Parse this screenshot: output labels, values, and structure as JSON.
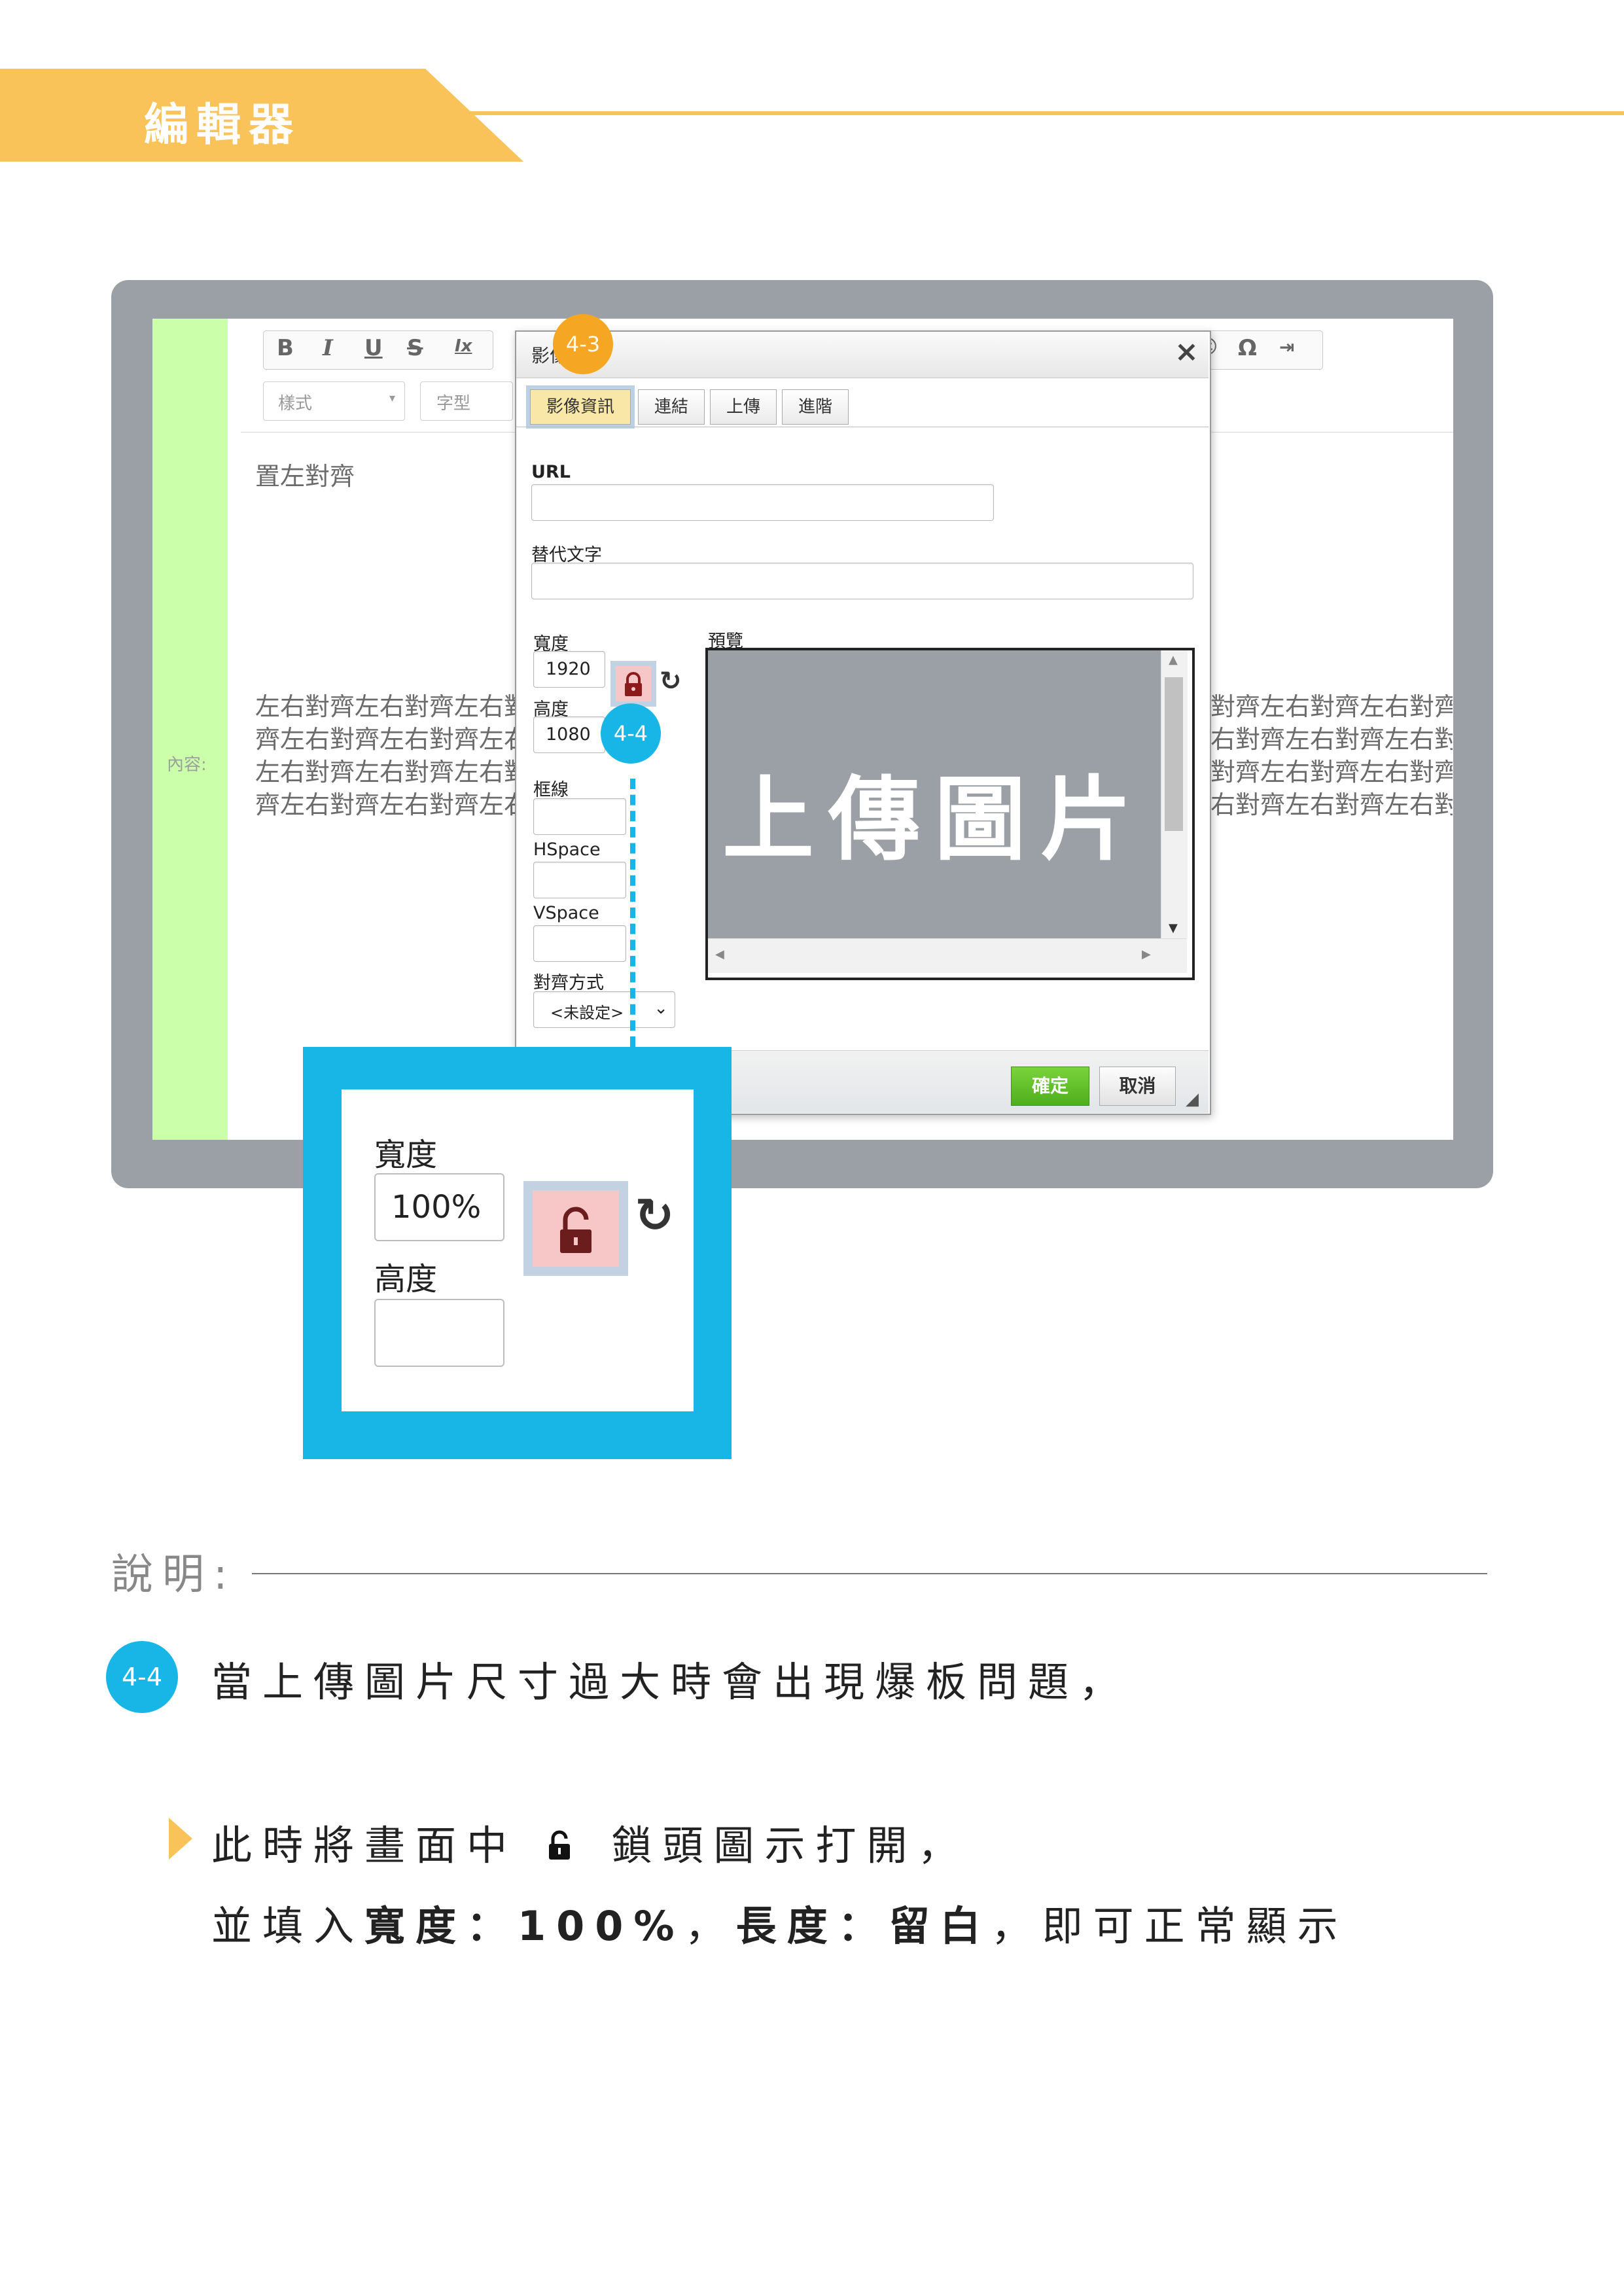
{
  "header": {
    "title": "編輯器"
  },
  "editor": {
    "toolbar": {
      "bold": "B",
      "italic": "I",
      "underline": "U",
      "strike": "S",
      "clear_format": "Ix",
      "omega": "Ω"
    },
    "format_combo": "樣式",
    "font_combo": "字型",
    "content_label": "內容:",
    "text_left": "置左對齊",
    "text_justify_left": [
      "左右對齊左右對齊左右對",
      "齊左右對齊左右對齊左右",
      "左右對齊左右對齊左右對",
      "齊左右對齊左右對齊左右"
    ],
    "text_justify_right": [
      "對齊左右對齊左右對齊",
      "右對齊左右對齊左右對齊",
      "對齊左右對齊左右對齊",
      "右對齊左右對齊左右對"
    ]
  },
  "dialog": {
    "title": "影像屬性",
    "close": "×",
    "tabs": [
      "影像資訊",
      "連結",
      "上傳",
      "進階"
    ],
    "url_label": "URL",
    "url_value": "",
    "alt_label": "替代文字",
    "alt_value": "",
    "width_label": "寬度",
    "width_value": "1920",
    "height_label": "高度",
    "height_value": "1080",
    "border_label": "框線",
    "hspace_label": "HSpace",
    "vspace_label": "VSpace",
    "align_label": "對齊方式",
    "align_value": "<未設定>",
    "preview_label": "預覽",
    "preview_image_text": "上傳圖片",
    "ok_button": "確定",
    "cancel_button": "取消"
  },
  "badges": {
    "step_3": "4-3",
    "step_4": "4-4"
  },
  "zoom": {
    "width_label": "寬度",
    "width_value": "100%",
    "height_label": "高度",
    "height_value": ""
  },
  "explanation": {
    "title": "說明:",
    "step_badge": "4-4",
    "line1": "當上傳圖片尺寸過大時會出現爆板問題，",
    "line2_pre": "此時將畫面中",
    "line2_post": "鎖頭圖示打開，",
    "line3_a": "並填入",
    "line3_b": "寬度：100%",
    "line3_c": "，",
    "line3_d": "長度：留白",
    "line3_e": "，即可正常顯示"
  },
  "colors": {
    "accent_yellow": "#f9c35a",
    "accent_blue": "#18b6e6",
    "accent_orange": "#f5a623",
    "frame_gray": "#9aa0a5"
  }
}
